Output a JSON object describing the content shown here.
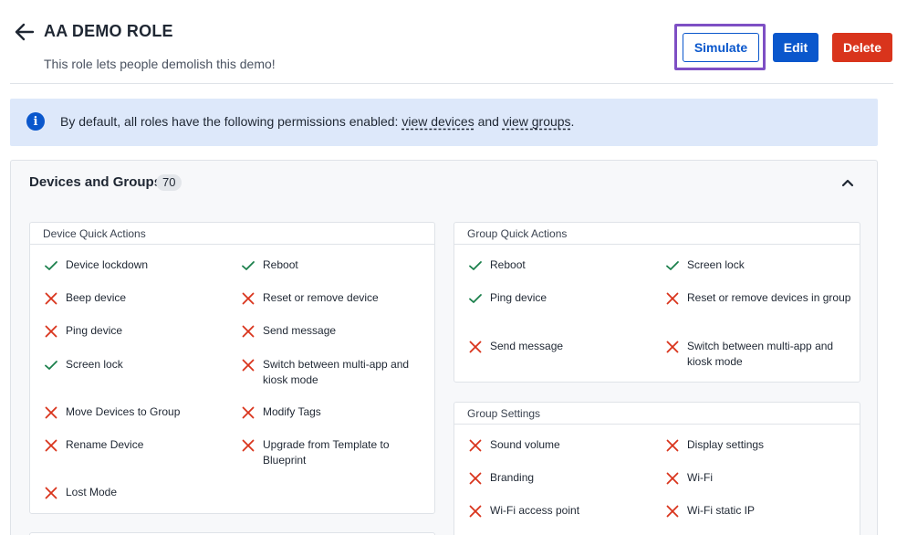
{
  "header": {
    "title": "AA DEMO ROLE",
    "subtitle": "This role lets people demolish this demo!",
    "buttons": {
      "simulate": "Simulate",
      "edit": "Edit",
      "delete": "Delete"
    }
  },
  "info_banner": {
    "text_before": "By default, all roles have the following permissions enabled: ",
    "link1": "view devices",
    "text_middle": " and ",
    "link2": "view groups",
    "text_after": "."
  },
  "section": {
    "title": "Devices and Groups",
    "count": "70"
  },
  "colors": {
    "allowed": "#1a7f4b",
    "denied": "#d9341c",
    "primary": "#0a57cc",
    "focus": "#7e4fc4"
  },
  "cards": {
    "device_quick_actions": {
      "title": "Device Quick Actions",
      "items": [
        {
          "label": "Device lockdown",
          "allowed": true
        },
        {
          "label": "Reboot",
          "allowed": true
        },
        {
          "label": "Beep device",
          "allowed": false
        },
        {
          "label": "Reset or remove device",
          "allowed": false
        },
        {
          "label": "Ping device",
          "allowed": false
        },
        {
          "label": "Send message",
          "allowed": false
        },
        {
          "label": "Screen lock",
          "allowed": true
        },
        {
          "label": "Switch between multi-app and kiosk mode",
          "allowed": false
        },
        {
          "label": "Move Devices to Group",
          "allowed": false
        },
        {
          "label": "Modify Tags",
          "allowed": false
        },
        {
          "label": "Rename Device",
          "allowed": false
        },
        {
          "label": "Upgrade from Template to Blueprint",
          "allowed": false
        },
        {
          "label": "Lost Mode",
          "allowed": false
        }
      ]
    },
    "group_quick_actions": {
      "title": "Group Quick Actions",
      "items": [
        {
          "label": "Reboot",
          "allowed": true
        },
        {
          "label": "Screen lock",
          "allowed": true
        },
        {
          "label": "Ping device",
          "allowed": true
        },
        {
          "label": "Reset or remove devices in group",
          "allowed": false
        },
        {
          "label": "Send message",
          "allowed": false
        },
        {
          "label": "Switch between multi-app and kiosk mode",
          "allowed": false
        }
      ]
    },
    "group_settings": {
      "title": "Group Settings",
      "items": [
        {
          "label": "Sound volume",
          "allowed": false
        },
        {
          "label": "Display settings",
          "allowed": false
        },
        {
          "label": "Branding",
          "allowed": false
        },
        {
          "label": "Wi-Fi",
          "allowed": false
        },
        {
          "label": "Wi-Fi access point",
          "allowed": false
        },
        {
          "label": "Wi-Fi static IP",
          "allowed": false
        }
      ]
    }
  }
}
